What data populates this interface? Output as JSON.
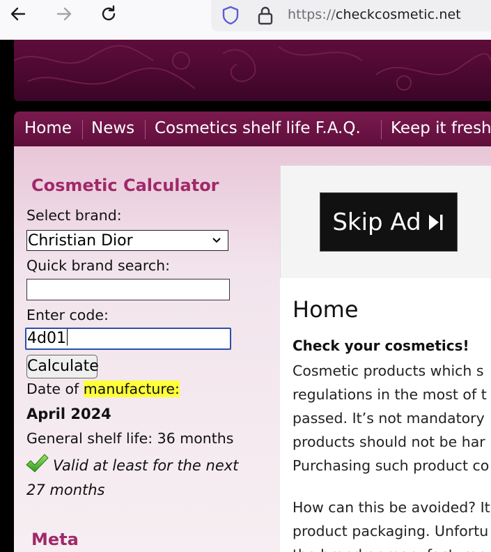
{
  "browser": {
    "url_scheme": "https://",
    "url_host": "checkcosmetic.net"
  },
  "menu": {
    "items": [
      "Home",
      "News",
      "Cosmetics shelf life F.A.Q.",
      "Keep it fresh"
    ]
  },
  "calculator": {
    "title": "Cosmetic Calculator",
    "brand_label": "Select brand:",
    "brand_value": "Christian Dior",
    "search_label": "Quick brand search:",
    "search_value": "",
    "code_label": "Enter code:",
    "code_value": "4d01",
    "button": "Calculate",
    "date_label_a": "Date of ",
    "date_label_b": "manufacture:",
    "date_value": "April 2024",
    "shelf_life": "General shelf life: 36 months",
    "valid_text": "Valid at least for the next 27 months"
  },
  "meta": {
    "title": "Meta"
  },
  "ad": {
    "skip_label": "Skip Ad"
  },
  "main": {
    "heading": "Home",
    "subheading": "Check your cosmetics!",
    "lines": [
      "Cosmetic products which s",
      "regulations in the most of t",
      "passed. It’s not mandatory",
      "products should not be har",
      "Purchasing such product co"
    ],
    "lines2": [
      "How can this be avoided? It",
      "product packaging. Unfortu",
      "the brand or manufacturer"
    ]
  },
  "colors": {
    "brand": "#a0296a",
    "menu": "#6b1444",
    "highlight": "#ffff3a"
  }
}
